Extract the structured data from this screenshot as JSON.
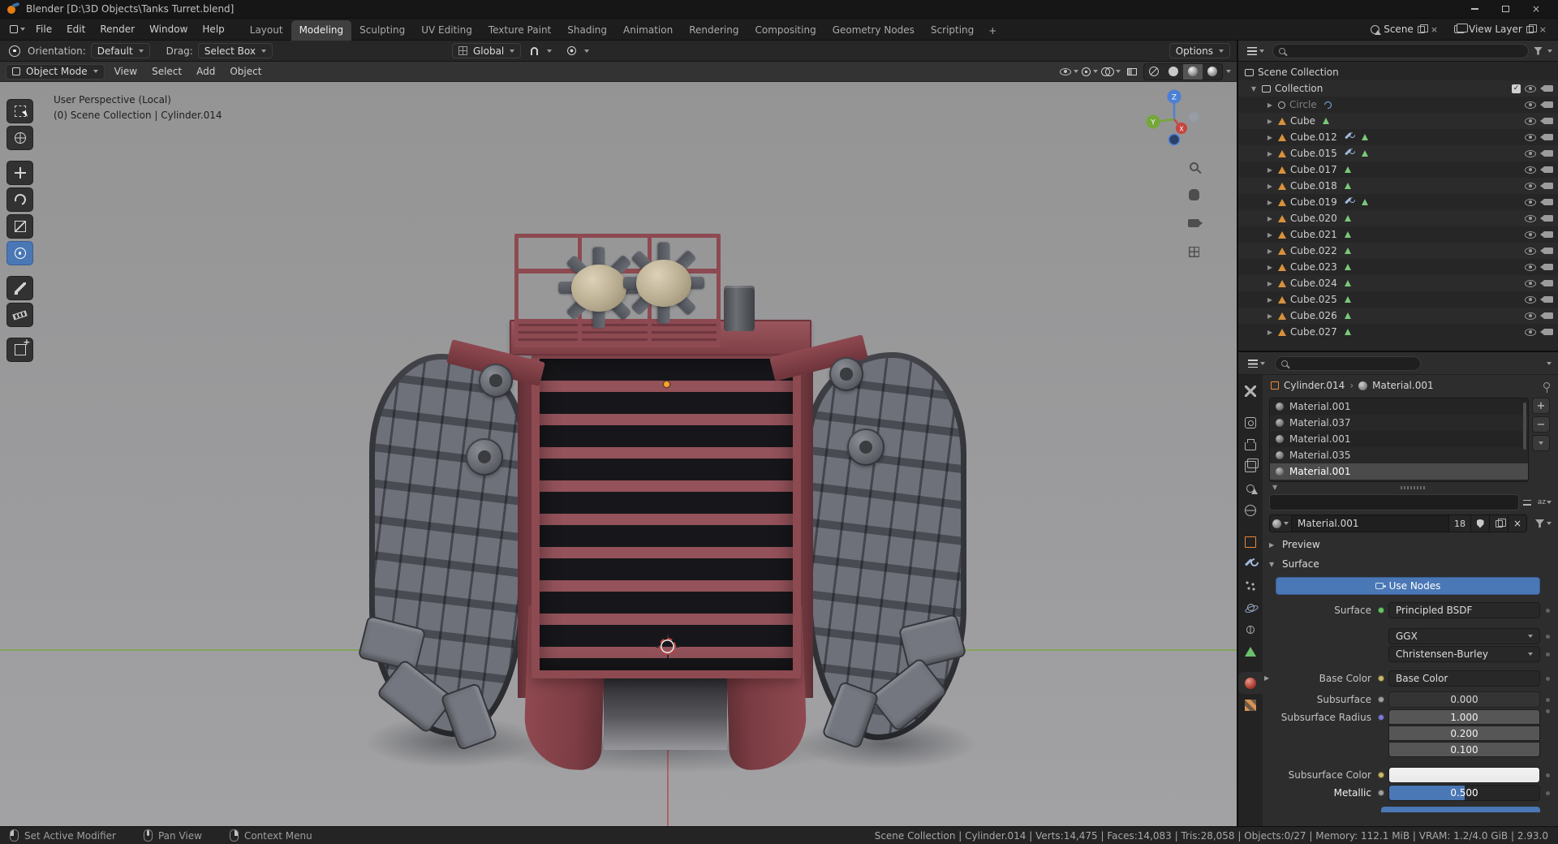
{
  "window": {
    "title": "Blender [D:\\3D Objects\\Tanks Turret.blend]"
  },
  "menubar": {
    "menus": [
      "File",
      "Edit",
      "Render",
      "Window",
      "Help"
    ],
    "workspaces": [
      "Layout",
      "Modeling",
      "Sculpting",
      "UV Editing",
      "Texture Paint",
      "Shading",
      "Animation",
      "Rendering",
      "Compositing",
      "Geometry Nodes",
      "Scripting"
    ],
    "active_workspace": "Modeling",
    "new_workspace_label": "+",
    "scene_selector": {
      "label": "Scene"
    },
    "view_layer_selector": {
      "label": "View Layer"
    }
  },
  "tool_settings": {
    "orientation_label": "Orientation:",
    "orientation_value": "Default",
    "drag_label": "Drag:",
    "drag_value": "Select Box",
    "transform_space": "Global",
    "options_label": "Options"
  },
  "viewport": {
    "header": {
      "mode": "Object Mode",
      "menus": [
        "View",
        "Select",
        "Add",
        "Object"
      ],
      "shading_modes": [
        {
          "name": "wireframe",
          "active": false
        },
        {
          "name": "solid",
          "active": false
        },
        {
          "name": "material-preview",
          "active": true
        },
        {
          "name": "rendered",
          "active": false
        }
      ]
    },
    "overlay": {
      "line1": "User Perspective (Local)",
      "line2": "(0) Scene Collection | Cylinder.014"
    },
    "tools": [
      "select-box",
      "cursor",
      "move",
      "rotate",
      "scale",
      "transform",
      "annotate",
      "measure",
      "add-cube"
    ],
    "active_tool": "transform",
    "side_icons": [
      "zoom",
      "pan",
      "camera",
      "grid"
    ],
    "gizmo_axes": [
      "X",
      "Y",
      "Z"
    ]
  },
  "outliner": {
    "search_placeholder": "",
    "root": "Scene Collection",
    "collection": "Collection",
    "items": [
      {
        "name": "Circle",
        "icon": "curve",
        "dim": true,
        "badges": [
          "curve"
        ]
      },
      {
        "name": "Cube",
        "icon": "mesh",
        "dim": false,
        "badges": [
          "data"
        ]
      },
      {
        "name": "Cube.012",
        "icon": "mesh",
        "dim": false,
        "badges": [
          "modifier",
          "data"
        ]
      },
      {
        "name": "Cube.015",
        "icon": "mesh",
        "dim": false,
        "badges": [
          "modifier",
          "data"
        ]
      },
      {
        "name": "Cube.017",
        "icon": "mesh",
        "dim": false,
        "badges": [
          "data"
        ]
      },
      {
        "name": "Cube.018",
        "icon": "mesh",
        "dim": false,
        "badges": [
          "data"
        ]
      },
      {
        "name": "Cube.019",
        "icon": "mesh",
        "dim": false,
        "badges": [
          "modifier",
          "data"
        ]
      },
      {
        "name": "Cube.020",
        "icon": "mesh",
        "dim": false,
        "badges": [
          "data"
        ]
      },
      {
        "name": "Cube.021",
        "icon": "mesh",
        "dim": false,
        "badges": [
          "data"
        ]
      },
      {
        "name": "Cube.022",
        "icon": "mesh",
        "dim": false,
        "badges": [
          "data"
        ]
      },
      {
        "name": "Cube.023",
        "icon": "mesh",
        "dim": false,
        "badges": [
          "data"
        ]
      },
      {
        "name": "Cube.024",
        "icon": "mesh",
        "dim": false,
        "badges": [
          "data"
        ]
      },
      {
        "name": "Cube.025",
        "icon": "mesh",
        "dim": false,
        "badges": [
          "data"
        ]
      },
      {
        "name": "Cube.026",
        "icon": "mesh",
        "dim": false,
        "badges": [
          "data"
        ]
      },
      {
        "name": "Cube.027",
        "icon": "mesh",
        "dim": false,
        "badges": [
          "data"
        ]
      }
    ]
  },
  "properties": {
    "search_placeholder": "",
    "tabs": [
      "tool",
      "render",
      "output",
      "view-layer",
      "scene",
      "world",
      "object",
      "modifiers",
      "particles",
      "physics",
      "constraints",
      "object-data",
      "material",
      "texture"
    ],
    "active_tab": "material",
    "breadcrumb": {
      "object": "Cylinder.014",
      "separator": "›",
      "material": "Material.001"
    },
    "slots": [
      "Material.001",
      "Material.037",
      "Material.001",
      "Material.035",
      "Material.001"
    ],
    "selected_slot": 4,
    "slot_add_label": "+",
    "slot_remove_label": "−",
    "material_field": {
      "name": "Material.001",
      "users": "18"
    },
    "preview_section": "Preview",
    "surface_section": "Surface",
    "use_nodes": "Use Nodes",
    "rows": [
      {
        "label": "Surface",
        "value": "Principled BSDF",
        "socket": "#67c767",
        "type": "menu"
      },
      {
        "label": "",
        "value": "GGX",
        "socket": "",
        "type": "dropdown"
      },
      {
        "label": "",
        "value": "Christensen-Burley",
        "socket": "",
        "type": "dropdown"
      },
      {
        "label": "Base Color",
        "value": "Base Color",
        "socket": "#c8b96a",
        "type": "menu",
        "expand": true
      },
      {
        "label": "Subsurface",
        "value": "0.000",
        "socket": "#9e9e9e",
        "type": "number"
      },
      {
        "label": "Subsurface Radius",
        "values": [
          "1.000",
          "0.200",
          "0.100"
        ],
        "socket": "#7a7ad0",
        "type": "vector"
      },
      {
        "label": "Subsurface Color",
        "swatch": "#e9e9e9",
        "socket": "#c8b96a",
        "type": "color"
      },
      {
        "label": "Metallic",
        "value": "0.500",
        "socket": "#9e9e9e",
        "type": "slider",
        "fill": 0.5,
        "highlight": true
      }
    ]
  },
  "statusbar": {
    "hints": [
      {
        "icon": "mouse-left",
        "label": "Set Active Modifier"
      },
      {
        "icon": "mouse-middle",
        "label": "Pan View"
      },
      {
        "icon": "mouse-right",
        "label": "Context Menu"
      }
    ],
    "stats": "Scene Collection | Cylinder.014 | Verts:14,475 | Faces:14,083 | Tris:28,058 | Objects:0/27 | Memory: 112.1 MiB | VRAM: 1.2/4.0 GiB | 2.93.0"
  }
}
